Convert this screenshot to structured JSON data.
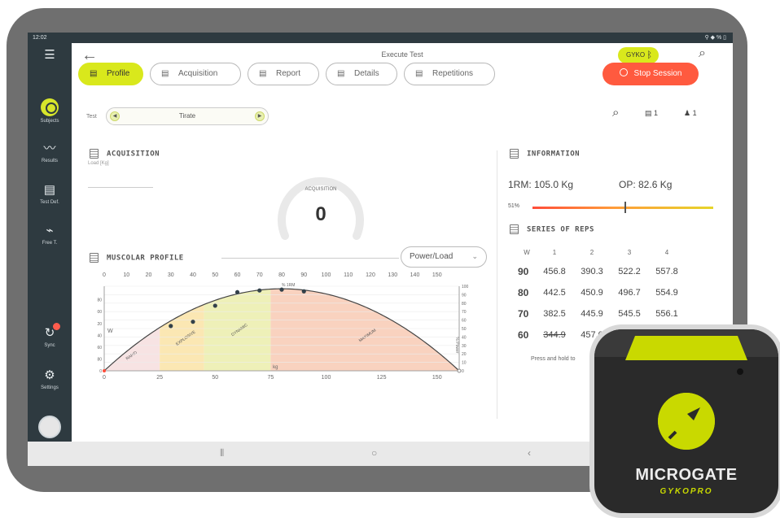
{
  "statusbar": {
    "time": "12:02",
    "right_icons": "⚲ ◆ % ▯"
  },
  "sidebar": {
    "items": [
      {
        "label": "Subjects",
        "icon": "subjects-icon"
      },
      {
        "label": "Results",
        "icon": "results-icon"
      },
      {
        "label": "Test Def.",
        "icon": "test-def-icon"
      },
      {
        "label": "Free T.",
        "icon": "free-test-icon"
      },
      {
        "label": "Sync",
        "icon": "sync-icon"
      },
      {
        "label": "Settings",
        "icon": "settings-icon"
      }
    ]
  },
  "topbar": {
    "title": "Execute Test",
    "device_pill": "GYKO"
  },
  "tabs": [
    {
      "label": "Profile",
      "active": true
    },
    {
      "label": "Acquisition",
      "active": false
    },
    {
      "label": "Report",
      "active": false
    },
    {
      "label": "Details",
      "active": false
    },
    {
      "label": "Repetitions",
      "active": false
    }
  ],
  "stop_button": "Stop Session",
  "test": {
    "label": "Test",
    "value": "Tirate"
  },
  "toolbar": {
    "count_a": "1",
    "count_b": "1"
  },
  "acquisition": {
    "title": "ACQUISITION",
    "load_label": "Load [Kg]",
    "gauge_label": "ACQUISITION",
    "gauge_value": "0"
  },
  "muscular_profile": {
    "title": "MUSCOLAR PROFILE",
    "select_value": "Power/Load"
  },
  "information": {
    "title": "INFORMATION",
    "rm": "1RM: 105.0 Kg",
    "op": "OP: 82.6 Kg",
    "percent": "51%",
    "marker_fraction": 0.51
  },
  "series": {
    "title": "SERIES OF REPS",
    "headers": [
      "W",
      "1",
      "2",
      "3",
      "4"
    ],
    "rows": [
      {
        "w": "90",
        "values": [
          "456.8",
          "390.3",
          "522.2",
          "557.8"
        ]
      },
      {
        "w": "80",
        "values": [
          "442.5",
          "450.9",
          "496.7",
          "554.9"
        ]
      },
      {
        "w": "70",
        "values": [
          "382.5",
          "445.9",
          "545.5",
          "556.1"
        ]
      },
      {
        "w": "60",
        "values": [
          "344.9",
          "457.0",
          "",
          ""
        ]
      }
    ],
    "hint": "Press and hold to"
  },
  "chart_data": {
    "type": "scatter",
    "title": "",
    "xlabel": "kg",
    "ylabel": "W",
    "y2label": "% Power",
    "top_axis_label": "% 1RM",
    "x_ticks_bottom": [
      "0",
      "25",
      "50",
      "75",
      "100",
      "125",
      "150"
    ],
    "x_ticks_top": [
      "0",
      "10",
      "20",
      "30",
      "40",
      "50",
      "60",
      "70",
      "80",
      "90",
      "100",
      "110",
      "120",
      "130",
      "140",
      "150"
    ],
    "y_ticks_left": [
      "0",
      "80",
      "60",
      "40",
      "20",
      "00",
      "80"
    ],
    "y_ticks_right": [
      "0",
      "10",
      "20",
      "30",
      "40",
      "50",
      "60",
      "70",
      "80",
      "90",
      "100"
    ],
    "zones": [
      {
        "name": "RAPID",
        "from": 0,
        "to": 25,
        "color": "#f7e3e3"
      },
      {
        "name": "EXPLOSIVE",
        "from": 25,
        "to": 45,
        "color": "#fbe7b3"
      },
      {
        "name": "DYNAMIC",
        "from": 45,
        "to": 75,
        "color": "#eef0b8"
      },
      {
        "name": "MAXIMUM",
        "from": 75,
        "to": 160,
        "color": "#f9d2bf"
      }
    ],
    "xlim": [
      0,
      160
    ],
    "ylim": [
      0,
      100
    ],
    "curve_peak_x": 80,
    "points": [
      {
        "x": 30,
        "y": 53
      },
      {
        "x": 40,
        "y": 58
      },
      {
        "x": 50,
        "y": 77
      },
      {
        "x": 60,
        "y": 93
      },
      {
        "x": 70,
        "y": 95
      },
      {
        "x": 80,
        "y": 96
      },
      {
        "x": 90,
        "y": 94
      }
    ]
  }
}
